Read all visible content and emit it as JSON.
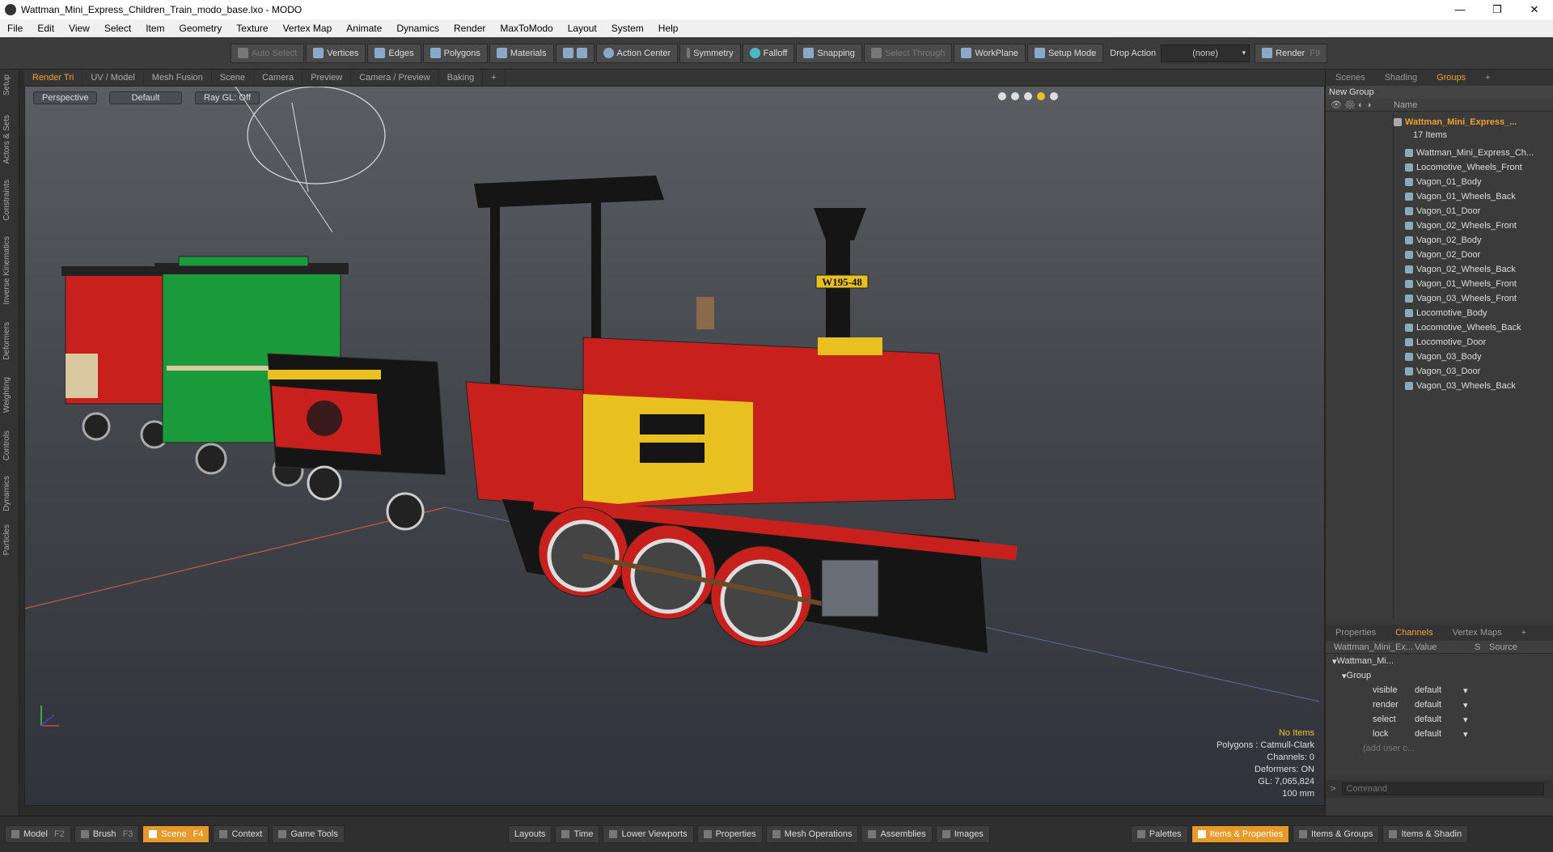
{
  "window": {
    "title": "Wattman_Mini_Express_Children_Train_modo_base.lxo - MODO",
    "controls": [
      "—",
      "❐",
      "✕"
    ]
  },
  "menu": [
    "File",
    "Edit",
    "View",
    "Select",
    "Item",
    "Geometry",
    "Texture",
    "Vertex Map",
    "Animate",
    "Dynamics",
    "Render",
    "MaxToModo",
    "Layout",
    "System",
    "Help"
  ],
  "toolbar": {
    "auto_select": "Auto Select",
    "vertices": "Vertices",
    "edges": "Edges",
    "polygons": "Polygons",
    "materials": "Materials",
    "action_center": "Action Center",
    "symmetry": "Symmetry",
    "falloff": "Falloff",
    "snapping": "Snapping",
    "select_through": "Select Through",
    "workplane": "WorkPlane",
    "setup_mode": "Setup Mode",
    "drop_action": "Drop Action",
    "drop_value": "(none)",
    "render": "Render",
    "render_key": "F9"
  },
  "left_tabs": [
    "Setup",
    "Actors & Sets",
    "Constraints",
    "Inverse Kinematics",
    "Deformers",
    "Weighting",
    "Controls",
    "Dynamics",
    "Particles"
  ],
  "viewport_tabs": [
    "Render Tri",
    "UV / Model",
    "Mesh Fusion",
    "Scene",
    "Camera",
    "Preview",
    "Camera / Preview",
    "Baking",
    "+"
  ],
  "viewport": {
    "view": "Perspective",
    "shading": "Default",
    "raygl": "Ray GL: Off",
    "loco_plate": "W195-48",
    "info": {
      "selection": "No Items",
      "polygons": "Polygons : Catmull-Clark",
      "channels": "Channels: 0",
      "deformers": "Deformers: ON",
      "gl": "GL: 7,065,824",
      "scale": "100 mm"
    }
  },
  "scene_tabs": [
    "Scenes",
    "Shading",
    "Groups",
    "+"
  ],
  "groups": {
    "new_group": "New Group",
    "name_col": "Name",
    "root": "Wattman_Mini_Express_...",
    "count": "17 Items",
    "items": [
      "Wattman_Mini_Express_Ch...",
      "Locomotive_Wheels_Front",
      "Vagon_01_Body",
      "Vagon_01_Wheels_Back",
      "Vagon_01_Door",
      "Vagon_02_Wheels_Front",
      "Vagon_02_Body",
      "Vagon_02_Door",
      "Vagon_02_Wheels_Back",
      "Vagon_01_Wheels_Front",
      "Vagon_03_Wheels_Front",
      "Locomotive_Body",
      "Locomotive_Wheels_Back",
      "Locomotive_Door",
      "Vagon_03_Body",
      "Vagon_03_Door",
      "Vagon_03_Wheels_Back"
    ]
  },
  "channels_tabs": [
    "Properties",
    "Channels",
    "Vertex Maps",
    "+"
  ],
  "channels": {
    "col_name": "Wattman_Mini_Ex...",
    "col_value": "Value",
    "col_s": "S",
    "col_source": "Source",
    "root": "Wattman_Mi...",
    "group": "Group",
    "rows": [
      {
        "name": "visible",
        "value": "default"
      },
      {
        "name": "render",
        "value": "default"
      },
      {
        "name": "select",
        "value": "default"
      },
      {
        "name": "lock",
        "value": "default"
      }
    ],
    "add_user": "(add user c...",
    "command_placeholder": "Command"
  },
  "bottom": {
    "model": "Model",
    "model_key": "F2",
    "brush": "Brush",
    "brush_key": "F3",
    "scene": "Scene",
    "scene_key": "F4",
    "context": "Context",
    "game_tools": "Game Tools",
    "layouts": "Layouts",
    "time": "Time",
    "lower_viewports": "Lower Viewports",
    "properties": "Properties",
    "mesh_ops": "Mesh Operations",
    "assemblies": "Assemblies",
    "images": "Images",
    "palettes": "Palettes",
    "items_props": "Items & Properties",
    "items_groups": "Items & Groups",
    "items_shading": "Items & Shadin"
  }
}
